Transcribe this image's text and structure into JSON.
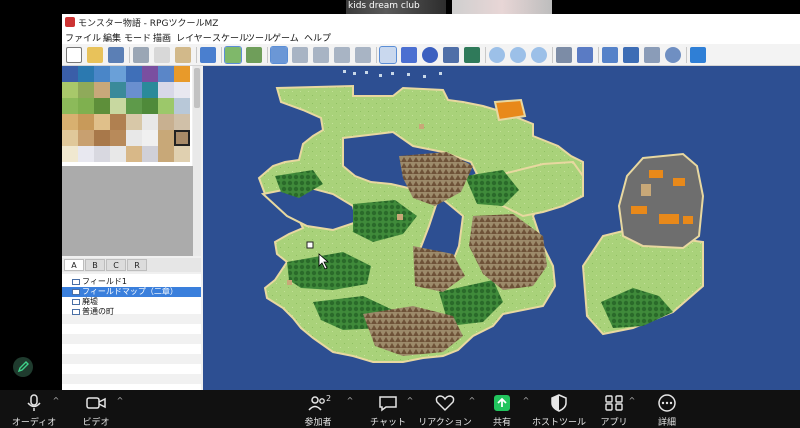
{
  "zoom_top": {
    "participant_name": "kids dream club"
  },
  "window": {
    "title": "モンスター物語 - RPGツクールMZ",
    "menu": [
      "ファイル",
      "編集",
      "モード",
      "描画",
      "レイヤー",
      "スケール",
      "ツール",
      "ゲーム",
      "ヘルプ"
    ]
  },
  "toolbar": {
    "icons": [
      "new-project-icon",
      "open-project-icon",
      "save-project-icon",
      "cut-icon",
      "copy-icon",
      "paste-icon",
      "undo-icon",
      "map-mode-icon",
      "event-mode-icon",
      "layer-auto-icon",
      "layer-1-icon",
      "layer-2-icon",
      "layer-3-icon",
      "layer-4-icon",
      "pencil-icon",
      "rectangle-icon",
      "ellipse-icon",
      "fill-icon",
      "shadow-pen-icon",
      "zoom-in-icon",
      "zoom-out-icon",
      "zoom-actual-icon",
      "database-icon",
      "plugin-manager-icon",
      "sound-test-icon",
      "event-searcher-icon",
      "character-generator-icon",
      "resource-manager-icon",
      "playtest-icon"
    ]
  },
  "tabs": [
    "A",
    "B",
    "C",
    "R"
  ],
  "map_list": [
    {
      "label": "フィールド1",
      "selected": false,
      "indent": 1
    },
    {
      "label": "フィールドマップ（二章）",
      "selected": true,
      "indent": 1
    },
    {
      "label": "廃墟",
      "selected": false,
      "indent": 1
    },
    {
      "label": "普通の町",
      "selected": false,
      "indent": 1
    }
  ],
  "zoom_bar": {
    "items": [
      {
        "label": "オーディオ",
        "icon": "microphone-icon"
      },
      {
        "label": "ビデオ",
        "icon": "video-camera-icon"
      },
      {
        "label": "参加者",
        "icon": "participants-icon",
        "badge": "2"
      },
      {
        "label": "チャット",
        "icon": "chat-icon"
      },
      {
        "label": "リアクション",
        "icon": "heart-icon"
      },
      {
        "label": "共有",
        "icon": "share-screen-icon"
      },
      {
        "label": "ホストツール",
        "icon": "shield-icon"
      },
      {
        "label": "アプリ",
        "icon": "apps-icon"
      },
      {
        "label": "詳細",
        "icon": "more-icon"
      }
    ]
  },
  "colors": {
    "ocean": "#2d4f92",
    "grass": "#a9d27a",
    "forest": "#2e7d32",
    "mountain": "#8a6a4a",
    "lava": "#e8891a",
    "rock": "#6e6e6e",
    "share_green": "#22c55e",
    "selected_blue": "#3a7fdc"
  }
}
